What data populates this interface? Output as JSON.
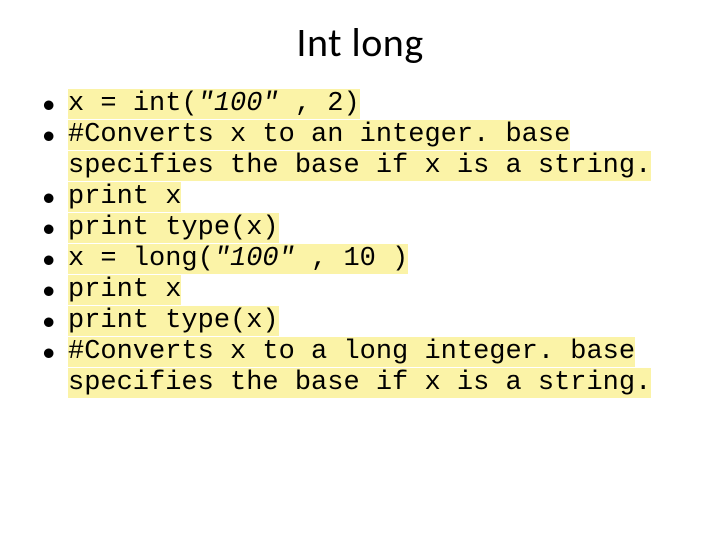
{
  "title": "Int long",
  "bullets": [
    {
      "parts": [
        {
          "t": "x = ",
          "cls": ""
        },
        {
          "t": "int(",
          "cls": ""
        },
        {
          "t": "\"100\" ",
          "cls": "str"
        },
        {
          "t": ", 2)",
          "cls": ""
        }
      ]
    },
    {
      "parts": [
        {
          "t": "#Converts x to an integer. base specifies the base if x is a string.",
          "cls": ""
        }
      ]
    },
    {
      "parts": [
        {
          "t": "print x",
          "cls": ""
        }
      ]
    },
    {
      "parts": [
        {
          "t": "print type(x)",
          "cls": ""
        }
      ]
    },
    {
      "parts": [
        {
          "t": "x =  ",
          "cls": ""
        },
        {
          "t": "long(",
          "cls": ""
        },
        {
          "t": "\"100\" ",
          "cls": "str"
        },
        {
          "t": ", 10 )",
          "cls": ""
        }
      ]
    },
    {
      "parts": [
        {
          "t": "print x",
          "cls": ""
        }
      ]
    },
    {
      "parts": [
        {
          "t": "print type(x)",
          "cls": ""
        }
      ]
    },
    {
      "parts": [
        {
          "t": "#Converts x to a long integer. base specifies the base if x is a string.",
          "cls": ""
        }
      ]
    }
  ]
}
